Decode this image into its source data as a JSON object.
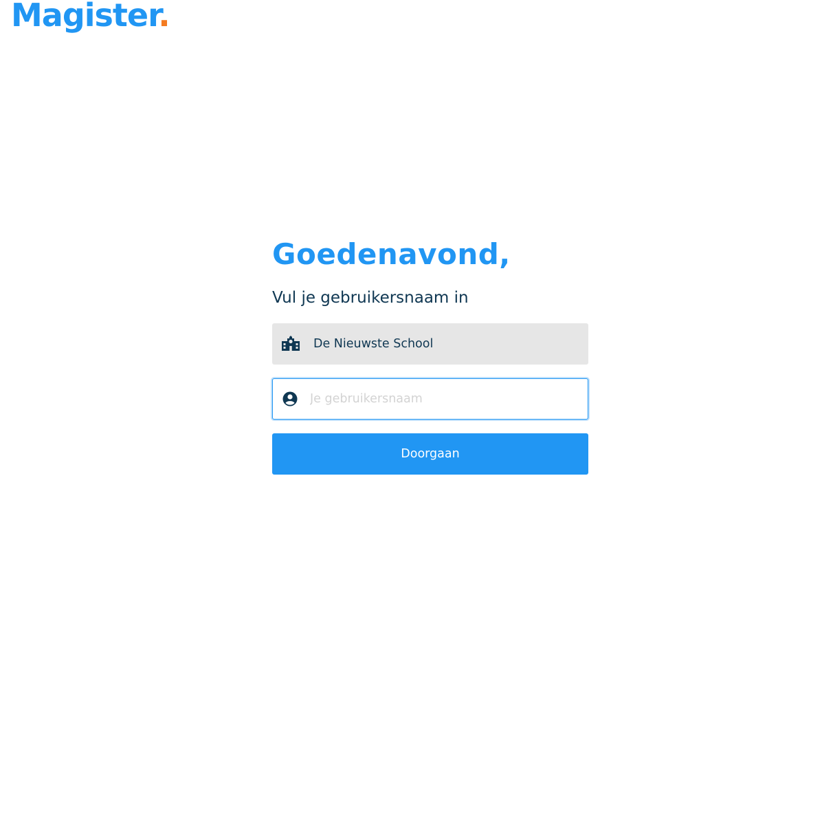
{
  "brand": {
    "logo_text": "Magister",
    "logo_dot": ".",
    "primary_color": "#2196f3",
    "accent_color": "#f47b20"
  },
  "login": {
    "greeting": "Goedenavond,",
    "subtitle": "Vul je gebruikersnaam in",
    "school": {
      "icon": "school-building-icon",
      "value": "De Nieuwste School"
    },
    "username": {
      "icon": "account-circle-icon",
      "value": "",
      "placeholder": "Je gebruikersnaam"
    },
    "continue_label": "Doorgaan"
  }
}
